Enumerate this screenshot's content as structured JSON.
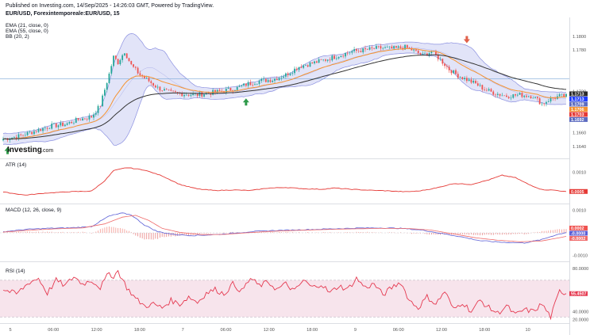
{
  "header": {
    "published": "Published on Investing.com, 14/Sep/2025 - 14:26:03 GMT, Powered by TradingView.",
    "symbol": "EUR/USD, Forexintemporeale:EUR/USD, 15"
  },
  "indicators": {
    "ema21": "EMA (21, close, 0)",
    "ema55": "EMA (55, close, 0)",
    "bb": "BB (20, 2)",
    "atr": "ATR (14)",
    "macd": "MACD (12, 26, close, 9)",
    "rsi": "RSI (14)"
  },
  "logo": {
    "text": "Investing",
    "suffix": ".com"
  },
  "colors": {
    "candle_up": "#26a69a",
    "candle_down": "#ef5350",
    "ema21": "#f5922f",
    "ema55": "#333333",
    "bb_band": "#8a8fe0",
    "bb_fill": "#dfe1f7",
    "atr_line": "#e53935",
    "macd_line": "#5b5fd6",
    "signal_line": "#ef6a6a",
    "rsi_line": "#e53950",
    "rsi_fill": "#f7e4ec",
    "price_ref_line": "#7aa7d8"
  },
  "chart_data": [
    {
      "type": "candlestick",
      "title": "EUR/USD, Forexintemporeale:EUR/USD, 15",
      "ylim": [
        1.1625,
        1.1825
      ],
      "y_ticks": [
        "1.1800",
        "1.1780",
        "1.1720",
        "1.1680",
        "1.1660",
        "1.1640"
      ],
      "x_ticks": [
        "5",
        "06:00",
        "12:00",
        "18:00",
        "7",
        "06:00",
        "12:00",
        "18:00",
        "9",
        "06:00",
        "12:00",
        "18:00",
        "10"
      ],
      "close_path": [
        [
          0,
          1.1651
        ],
        [
          6,
          1.1654
        ],
        [
          12,
          1.166
        ],
        [
          16,
          1.1664
        ],
        [
          22,
          1.167
        ],
        [
          28,
          1.1672
        ],
        [
          34,
          1.1679
        ],
        [
          40,
          1.1683
        ],
        [
          44,
          1.17
        ],
        [
          48,
          1.1745
        ],
        [
          50,
          1.177
        ],
        [
          52,
          1.1762
        ],
        [
          55,
          1.1778
        ],
        [
          58,
          1.1758
        ],
        [
          62,
          1.1744
        ],
        [
          66,
          1.1735
        ],
        [
          70,
          1.1725
        ],
        [
          76,
          1.1718
        ],
        [
          82,
          1.1716
        ],
        [
          88,
          1.1715
        ],
        [
          94,
          1.1718
        ],
        [
          100,
          1.1721
        ],
        [
          106,
          1.1725
        ],
        [
          110,
          1.173
        ],
        [
          116,
          1.1735
        ],
        [
          122,
          1.1737
        ],
        [
          128,
          1.1744
        ],
        [
          134,
          1.1756
        ],
        [
          140,
          1.1761
        ],
        [
          146,
          1.1766
        ],
        [
          152,
          1.1772
        ],
        [
          158,
          1.1778
        ],
        [
          164,
          1.178
        ],
        [
          170,
          1.1783
        ],
        [
          176,
          1.1782
        ],
        [
          182,
          1.1784
        ],
        [
          186,
          1.1779
        ],
        [
          190,
          1.1772
        ],
        [
          194,
          1.1778
        ],
        [
          198,
          1.1766
        ],
        [
          202,
          1.1752
        ],
        [
          206,
          1.1743
        ],
        [
          210,
          1.1737
        ],
        [
          214,
          1.1731
        ],
        [
          218,
          1.1723
        ],
        [
          222,
          1.1718
        ],
        [
          228,
          1.1713
        ],
        [
          234,
          1.1715
        ],
        [
          240,
          1.1713
        ],
        [
          244,
          1.1702
        ],
        [
          248,
          1.1709
        ],
        [
          252,
          1.1713
        ],
        [
          255,
          1.1713
        ]
      ],
      "series": [
        {
          "name": "EMA (21, close, 0)",
          "values_ref": "smoothed(21)"
        },
        {
          "name": "EMA (55, close, 0)",
          "values_ref": "smoothed(55)"
        },
        {
          "name": "BB (20, 2)",
          "values_ref": "bands(20)"
        }
      ],
      "price_labels": [
        {
          "value": "1.1713",
          "color": "#2b2b2b"
        },
        {
          "value": "1.1713",
          "color": "#1e3cff"
        },
        {
          "value": "1.1709",
          "color": "#5c6bc0"
        },
        {
          "value": "1.1706",
          "color": "#f5922f"
        },
        {
          "value": "1.1703",
          "color": "#e53935"
        },
        {
          "value": "1.1692",
          "color": "#5c6bc0"
        }
      ],
      "markers": [
        {
          "type": "buy-arrow",
          "bar": 2
        },
        {
          "type": "buy-arrow",
          "bar": 110
        },
        {
          "type": "sell-arrow",
          "bar": 210
        }
      ]
    },
    {
      "type": "line",
      "title": "ATR (14)",
      "ylim": [
        0,
        0.0014
      ],
      "y_ticks": [
        "0.0010"
      ],
      "last_value": "0.0005",
      "path": [
        [
          0,
          0.00035
        ],
        [
          10,
          0.00025
        ],
        [
          20,
          0.00032
        ],
        [
          30,
          0.00036
        ],
        [
          40,
          0.00038
        ],
        [
          46,
          0.00072
        ],
        [
          50,
          0.00105
        ],
        [
          56,
          0.00115
        ],
        [
          64,
          0.00107
        ],
        [
          72,
          0.00088
        ],
        [
          80,
          0.0006
        ],
        [
          88,
          0.00045
        ],
        [
          96,
          0.0004
        ],
        [
          104,
          0.00042
        ],
        [
          112,
          0.0004
        ],
        [
          120,
          0.00048
        ],
        [
          128,
          0.0005
        ],
        [
          136,
          0.00046
        ],
        [
          144,
          0.00044
        ],
        [
          150,
          0.00048
        ],
        [
          158,
          0.00044
        ],
        [
          166,
          0.00041
        ],
        [
          174,
          0.00039
        ],
        [
          182,
          0.00036
        ],
        [
          188,
          0.00038
        ],
        [
          196,
          0.00048
        ],
        [
          204,
          0.00063
        ],
        [
          212,
          0.0006
        ],
        [
          220,
          0.00075
        ],
        [
          226,
          0.0009
        ],
        [
          232,
          0.00082
        ],
        [
          238,
          0.0006
        ],
        [
          244,
          0.00043
        ],
        [
          250,
          0.00041
        ],
        [
          255,
          0.00036
        ]
      ]
    },
    {
      "type": "line",
      "title": "MACD (12, 26, close, 9)",
      "ylim": [
        -0.0012,
        0.0012
      ],
      "y_ticks": [
        "0.0010",
        "0.0000",
        "-0.0010"
      ],
      "last_values": [
        "0.0002",
        "-0.0000",
        "-0.0002"
      ],
      "series": [
        {
          "name": "MACD",
          "path": [
            [
              0,
              5e-05
            ],
            [
              10,
              0.00015
            ],
            [
              20,
              0.0002
            ],
            [
              30,
              0.00022
            ],
            [
              40,
              0.00028
            ],
            [
              48,
              0.00075
            ],
            [
              54,
              0.00088
            ],
            [
              58,
              0.0008
            ],
            [
              64,
              0.00035
            ],
            [
              70,
              5e-05
            ],
            [
              78,
              -8e-05
            ],
            [
              86,
              -0.00012
            ],
            [
              96,
              -8e-05
            ],
            [
              104,
              -2e-05
            ],
            [
              112,
              5e-05
            ],
            [
              122,
              0.0001
            ],
            [
              132,
              0.00013
            ],
            [
              140,
              0.00015
            ],
            [
              150,
              0.00018
            ],
            [
              160,
              0.00021
            ],
            [
              170,
              0.00022
            ],
            [
              180,
              0.0002
            ],
            [
              190,
              0.00012
            ],
            [
              198,
              -2e-05
            ],
            [
              206,
              -0.00015
            ],
            [
              216,
              -0.00035
            ],
            [
              226,
              -0.00042
            ],
            [
              236,
              -0.00045
            ],
            [
              244,
              -0.0003
            ],
            [
              250,
              -0.0001
            ],
            [
              255,
              2e-05
            ]
          ]
        },
        {
          "name": "Signal",
          "path": [
            [
              0,
              3e-05
            ],
            [
              12,
              0.00012
            ],
            [
              24,
              0.00018
            ],
            [
              36,
              0.00022
            ],
            [
              46,
              0.0004
            ],
            [
              54,
              0.0007
            ],
            [
              60,
              0.00078
            ],
            [
              66,
              0.00055
            ],
            [
              72,
              0.0002
            ],
            [
              80,
              2e-05
            ],
            [
              90,
              -8e-05
            ],
            [
              100,
              -7e-05
            ],
            [
              110,
              0.0
            ],
            [
              120,
              6e-05
            ],
            [
              130,
              0.0001
            ],
            [
              140,
              0.00013
            ],
            [
              150,
              0.00016
            ],
            [
              160,
              0.00018
            ],
            [
              172,
              0.0002
            ],
            [
              184,
              0.00019
            ],
            [
              194,
              0.00012
            ],
            [
              204,
              -5e-05
            ],
            [
              214,
              -0.00022
            ],
            [
              224,
              -0.00033
            ],
            [
              234,
              -0.0004
            ],
            [
              244,
              -0.00036
            ],
            [
              255,
              -0.00016
            ]
          ]
        }
      ]
    },
    {
      "type": "line",
      "title": "RSI (14)",
      "ylim": [
        25,
        88
      ],
      "y_ticks": [
        "80.0000",
        "40.0000",
        "20.0000"
      ],
      "bands": [
        70,
        30
      ],
      "last_value": "55.4507",
      "path": [
        [
          0,
          60
        ],
        [
          6,
          55
        ],
        [
          12,
          68
        ],
        [
          16,
          72
        ],
        [
          20,
          56
        ],
        [
          24,
          70
        ],
        [
          28,
          64
        ],
        [
          32,
          74
        ],
        [
          36,
          66
        ],
        [
          40,
          70
        ],
        [
          44,
          62
        ],
        [
          48,
          78
        ],
        [
          50,
          74
        ],
        [
          52,
          80
        ],
        [
          56,
          62
        ],
        [
          60,
          50
        ],
        [
          64,
          42
        ],
        [
          68,
          44
        ],
        [
          72,
          40
        ],
        [
          76,
          48
        ],
        [
          80,
          44
        ],
        [
          84,
          52
        ],
        [
          88,
          46
        ],
        [
          92,
          56
        ],
        [
          96,
          60
        ],
        [
          100,
          55
        ],
        [
          104,
          66
        ],
        [
          108,
          58
        ],
        [
          112,
          72
        ],
        [
          116,
          64
        ],
        [
          120,
          68
        ],
        [
          124,
          60
        ],
        [
          128,
          66
        ],
        [
          132,
          58
        ],
        [
          136,
          70
        ],
        [
          140,
          62
        ],
        [
          144,
          66
        ],
        [
          148,
          56
        ],
        [
          152,
          64
        ],
        [
          156,
          60
        ],
        [
          160,
          72
        ],
        [
          164,
          62
        ],
        [
          168,
          66
        ],
        [
          172,
          54
        ],
        [
          176,
          62
        ],
        [
          180,
          68
        ],
        [
          184,
          48
        ],
        [
          188,
          40
        ],
        [
          192,
          52
        ],
        [
          196,
          44
        ],
        [
          200,
          58
        ],
        [
          204,
          38
        ],
        [
          208,
          46
        ],
        [
          212,
          36
        ],
        [
          216,
          48
        ],
        [
          220,
          40
        ],
        [
          224,
          34
        ],
        [
          228,
          42
        ],
        [
          232,
          32
        ],
        [
          236,
          38
        ],
        [
          240,
          36
        ],
        [
          244,
          44
        ],
        [
          248,
          30
        ],
        [
          252,
          58
        ],
        [
          255,
          56
        ]
      ]
    }
  ]
}
